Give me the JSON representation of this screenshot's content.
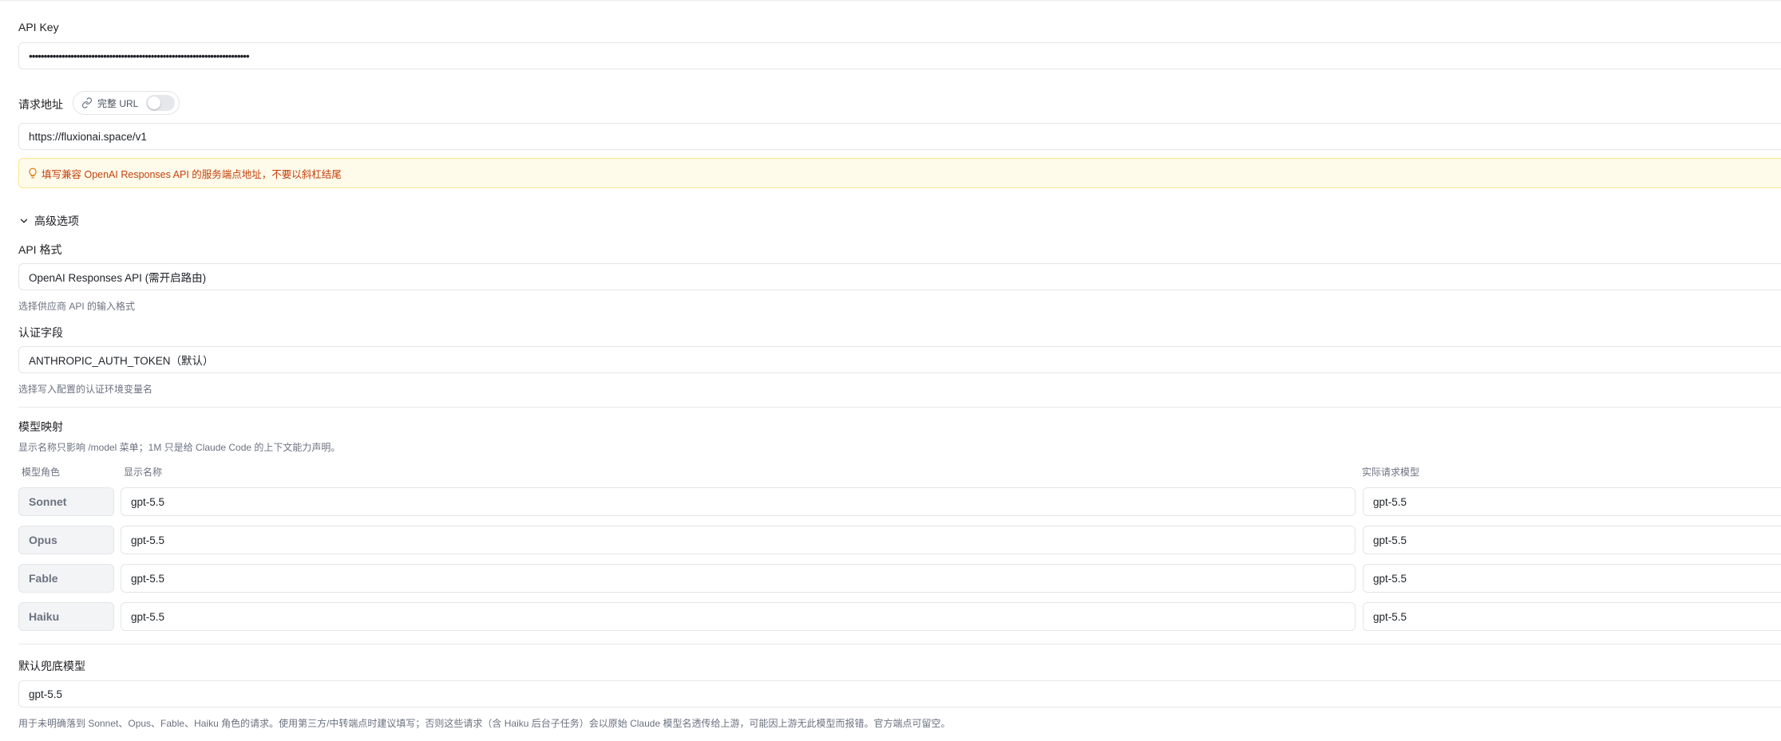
{
  "api_key": {
    "label": "API Key",
    "value": "••••••••••••••••••••••••••••••••••••••••••••••••••••••••••••••••••••••••••"
  },
  "request_url": {
    "label": "请求地址",
    "full_url_toggle_label": "完整 URL",
    "full_url_enabled": false,
    "value": "https://fluxionai.space/v1",
    "hint": "填写兼容 OpenAI Responses API 的服务端点地址，不要以斜杠结尾"
  },
  "advanced": {
    "toggle_label": "高级选项",
    "expanded": true,
    "api_format": {
      "label": "API 格式",
      "value": "OpenAI Responses API (需开启路由)",
      "help": "选择供应商 API 的输入格式"
    },
    "auth_field": {
      "label": "认证字段",
      "value": "ANTHROPIC_AUTH_TOKEN（默认）",
      "help": "选择写入配置的认证环境变量名"
    }
  },
  "model_mapping": {
    "title": "模型映射",
    "description": "显示名称只影响 /model 菜单；1M 只是给 Claude Code 的上下文能力声明。",
    "columns": [
      "模型角色",
      "显示名称",
      "实际请求模型"
    ],
    "rows": [
      {
        "role": "Sonnet",
        "display_name": "gpt-5.5",
        "request_model": "gpt-5.5"
      },
      {
        "role": "Opus",
        "display_name": "gpt-5.5",
        "request_model": "gpt-5.5"
      },
      {
        "role": "Fable",
        "display_name": "gpt-5.5",
        "request_model": "gpt-5.5"
      },
      {
        "role": "Haiku",
        "display_name": "gpt-5.5",
        "request_model": "gpt-5.5"
      }
    ]
  },
  "fallback_model": {
    "label": "默认兜底模型",
    "value": "gpt-5.5",
    "help": "用于未明确落到 Sonnet、Opus、Fable、Haiku 角色的请求。使用第三方/中转端点时建议填写；否则这些请求（含 Haiku 后台子任务）会以原始 Claude 模型名透传给上游，可能因上游无此模型而报错。官方端点可留空。"
  },
  "colors": {
    "border": "#e3e5e8",
    "warning_bg": "#fffbeb",
    "warning_text": "#c2410c",
    "muted_text": "#6b7280"
  }
}
